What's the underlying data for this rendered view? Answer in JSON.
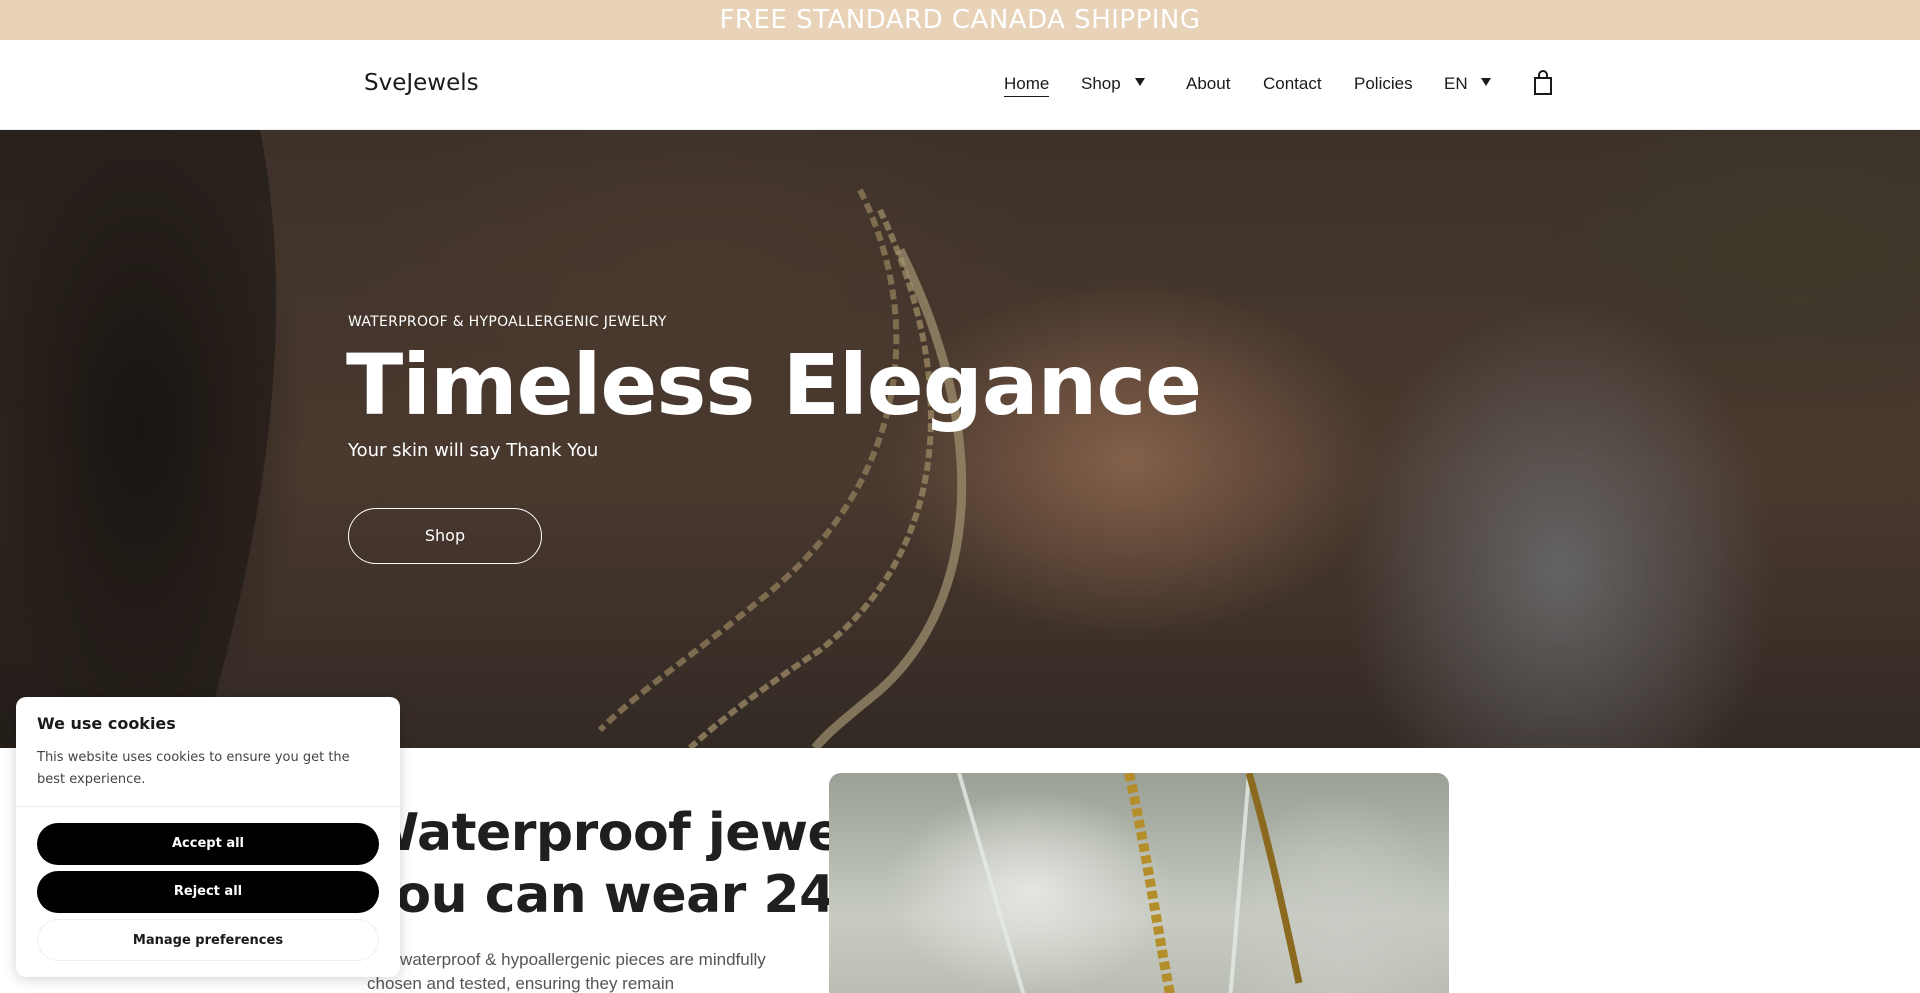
{
  "announcement": "FREE STANDARD CANADA SHIPPING",
  "header": {
    "logo": "SveJewels",
    "nav": [
      {
        "label": "Home",
        "active": true
      },
      {
        "label": "Shop",
        "dropdown": true
      },
      {
        "label": "About"
      },
      {
        "label": "Contact"
      },
      {
        "label": "Policies"
      },
      {
        "label": "EN",
        "dropdown": true
      }
    ],
    "cart_icon": "shopping-bag-icon"
  },
  "hero": {
    "eyebrow": "WATERPROOF & HYPOALLERGENIC JEWELRY",
    "title": "Timeless Elegance",
    "subtitle": "Your skin will say Thank You",
    "button": "Shop"
  },
  "feature": {
    "title_line1": "Waterproof jewelry",
    "title_line2": "you can wear 24/7",
    "text": "Our waterproof & hypoallergenic pieces are mindfully chosen and tested, ensuring they remain"
  },
  "cookie": {
    "title": "We use cookies",
    "text": "This website uses cookies to ensure you get the best experience.",
    "accept": "Accept all",
    "reject": "Reject all",
    "manage": "Manage preferences"
  },
  "colors": {
    "announcement_bg": "#e8d3b9",
    "button_dark": "#000000"
  }
}
